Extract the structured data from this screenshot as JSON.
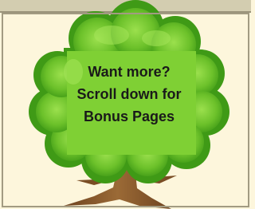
{
  "message": {
    "line1": "Want more?",
    "line2": "Scroll down for",
    "line3": "Bonus Pages"
  },
  "graphic": {
    "icon": "tree-illustration",
    "colors": {
      "canopy_dark": "#3f9a16",
      "canopy_main": "#6cc12a",
      "canopy_light": "#9be04d",
      "trunk": "#8a5a2b",
      "background": "#fdf6dc"
    }
  }
}
